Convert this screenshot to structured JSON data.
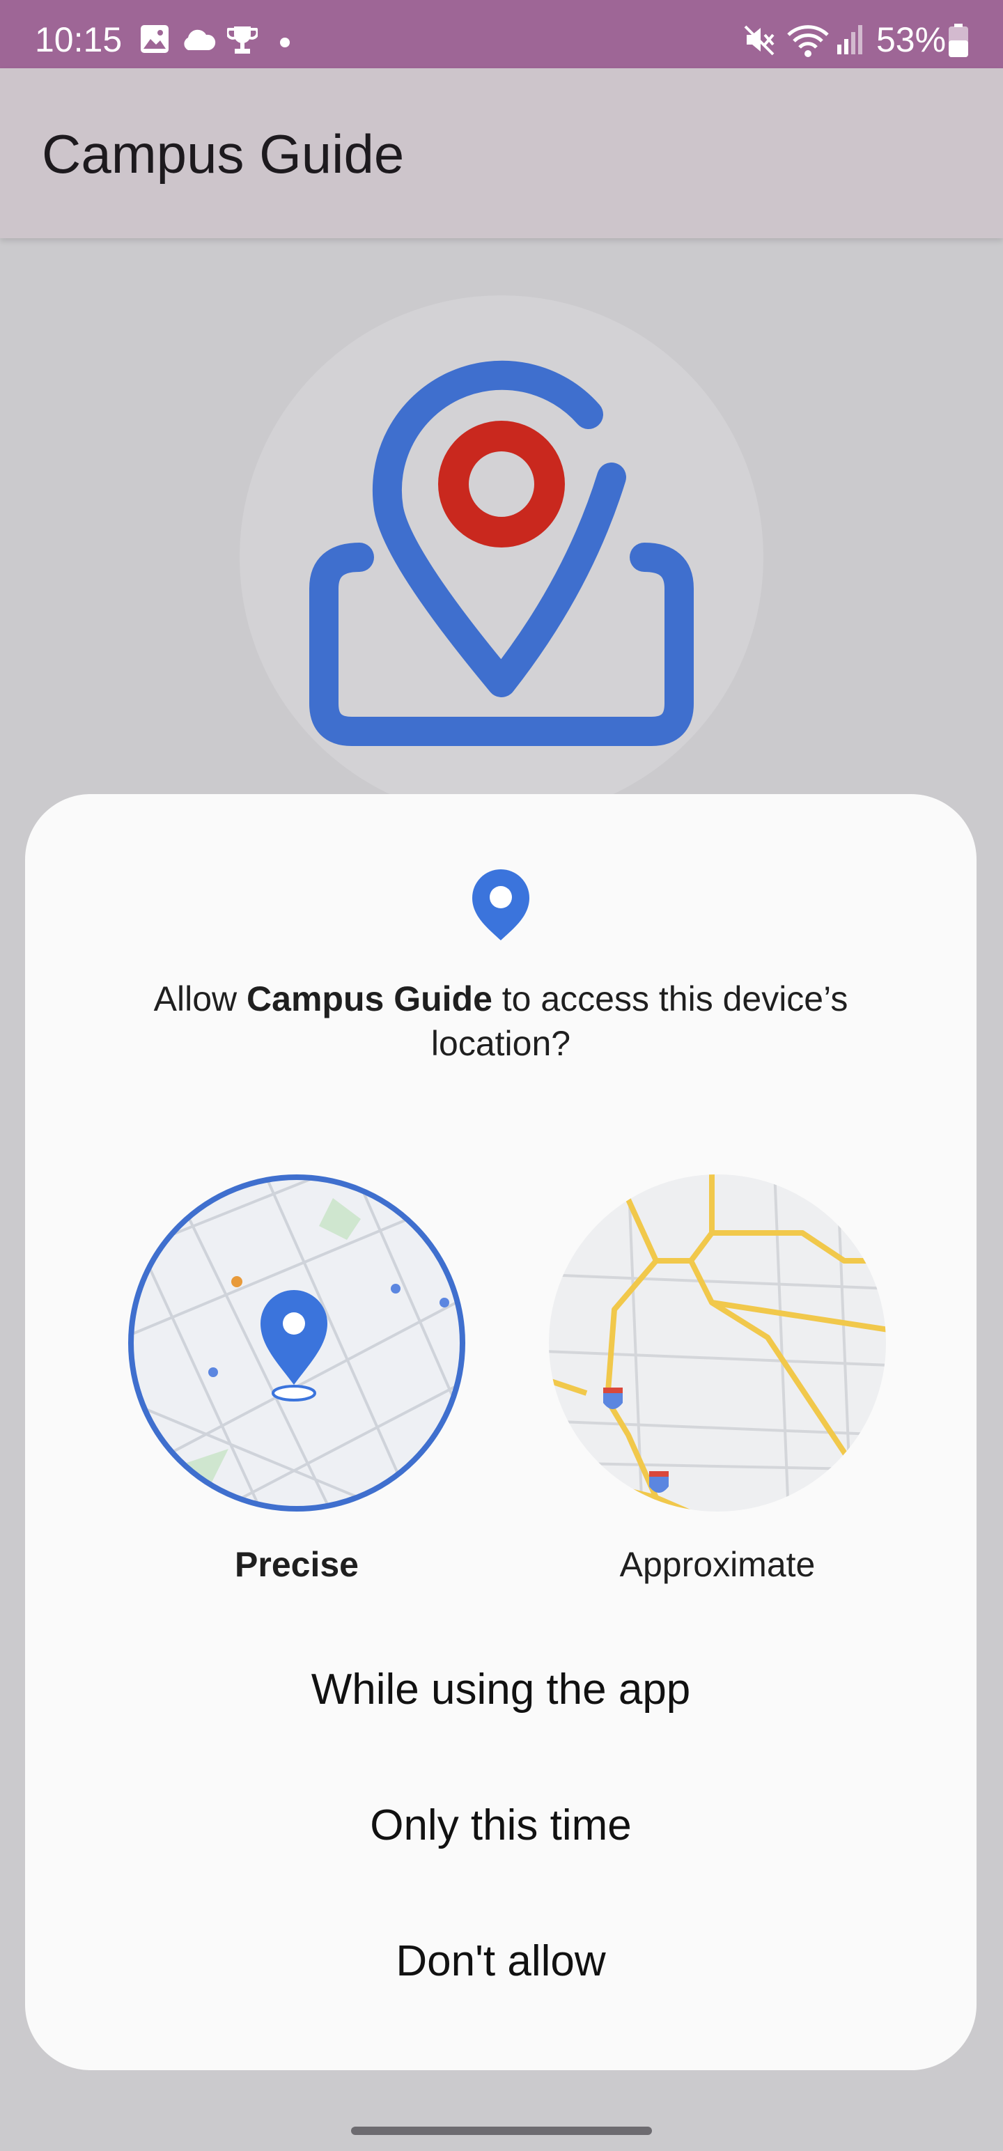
{
  "status_bar": {
    "time": "10:15",
    "battery": "53%",
    "icons": [
      "gallery-icon",
      "cloud-icon",
      "trophy-icon",
      "dot-icon",
      "mute-icon",
      "wifi-icon",
      "signal-icon",
      "battery-icon"
    ]
  },
  "app_bar": {
    "title": "Campus Guide"
  },
  "dialog": {
    "message_prefix": "Allow ",
    "app_name": "Campus Guide",
    "message_suffix": " to access this device’s location?",
    "options": [
      {
        "label": "Precise",
        "selected": true
      },
      {
        "label": "Approximate",
        "selected": false
      }
    ],
    "actions": [
      "While using the app",
      "Only this time",
      "Don't allow"
    ]
  },
  "colors": {
    "status_bar": "#9e6696",
    "app_bar": "#cdc5cb",
    "logo_blue": "#3f6fce",
    "logo_red": "#c9281e",
    "pin_blue": "#3b74dc",
    "road_yellow": "#f1c84b"
  }
}
